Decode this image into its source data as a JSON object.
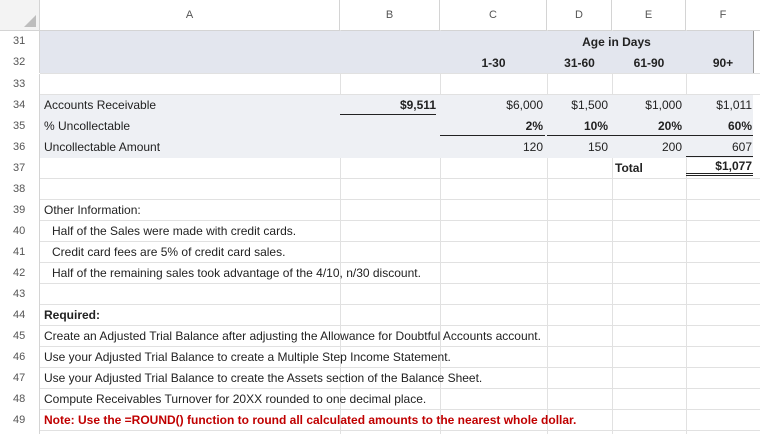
{
  "columns": [
    "A",
    "B",
    "C",
    "D",
    "E",
    "F"
  ],
  "rows": {
    "r31": "31",
    "r32": "32",
    "r33": "33",
    "r34": "34",
    "r35": "35",
    "r36": "36",
    "r37": "37",
    "r38": "38",
    "r39": "39",
    "r40": "40",
    "r41": "41",
    "r42": "42",
    "r43": "43",
    "r44": "44",
    "r45": "45",
    "r46": "46",
    "r47": "47",
    "r48": "48",
    "r49": "49"
  },
  "header": {
    "age_title": "Age in Days",
    "buckets": [
      "1-30",
      "31-60",
      "61-90",
      "90+"
    ]
  },
  "receivable": {
    "label": "Accounts Receivable",
    "total": "$9,511",
    "values": [
      "$6,000",
      "$1,500",
      "$1,000",
      "$1,011"
    ]
  },
  "uncollectable_pct": {
    "label": "% Uncollectable",
    "values": [
      "2%",
      "10%",
      "20%",
      "60%"
    ]
  },
  "uncollectable_amt": {
    "label": "Uncollectable Amount",
    "values": [
      "120",
      "150",
      "200",
      "607"
    ]
  },
  "totals": {
    "label": "Total",
    "value": "$1,077"
  },
  "other_info": {
    "title": "Other Information:",
    "lines": [
      "Half of the Sales were made with credit cards.",
      "Credit card fees are 5% of credit card sales.",
      "Half of the remaining sales took advantage of the 4/10, n/30 discount."
    ]
  },
  "required": {
    "title": "Required:",
    "lines": [
      "Create an Adjusted Trial Balance after adjusting the Allowance for Doubtful Accounts account.",
      "Use your Adjusted Trial Balance to create a Multiple Step Income Statement.",
      "Use your Adjusted Trial Balance to create the Assets section of the Balance Sheet.",
      "Compute Receivables Turnover for 20XX rounded to one decimal place."
    ],
    "note": "Note:  Use the =ROUND() function to round all calculated amounts to the nearest whole dollar."
  },
  "colors": {
    "header_band": "#e3e6ee",
    "note": "#c00000"
  }
}
